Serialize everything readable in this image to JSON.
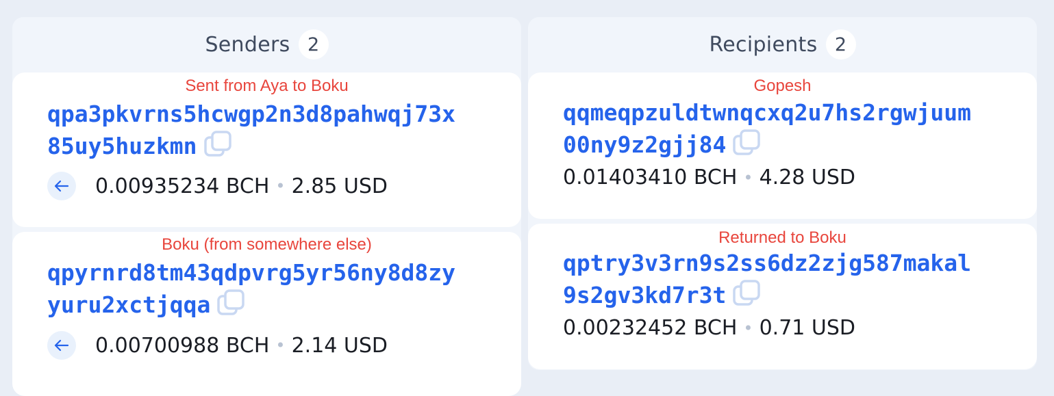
{
  "senders": {
    "title": "Senders",
    "count": "2",
    "items": [
      {
        "label": "Sent from Aya to Boku",
        "address_line1": "qpa3pkvrns5hcwgp2n3d8pahwqj73x",
        "address_line2": "85uy5huzkmn",
        "bch": "0.00935234 BCH",
        "usd": "2.85 USD",
        "icon": "arrow-left-icon"
      },
      {
        "label": "Boku (from somewhere else)",
        "address_line1": "qpyrnrd8tm43qdpvrg5yr56ny8d8zy",
        "address_line2": "yuru2xctjqqa",
        "bch": "0.00700988 BCH",
        "usd": "2.14 USD",
        "icon": "arrow-left-icon"
      }
    ]
  },
  "recipients": {
    "title": "Recipients",
    "count": "2",
    "items": [
      {
        "label": "Gopesh",
        "address_line1": "qqmeqpzuldtwnqcxq2u7hs2rgwjuum",
        "address_line2": "00ny9z2gjj84",
        "bch": "0.01403410 BCH",
        "usd": "4.28 USD"
      },
      {
        "label": "Returned to Boku",
        "address_line1": "qptry3v3rn9s2ss6dz2zjg587makal",
        "address_line2": "9s2gv3kd7r3t",
        "bch": "0.00232452 BCH",
        "usd": "0.71 USD"
      }
    ]
  },
  "separator": "•",
  "colors": {
    "address": "#2563eb",
    "label": "#e8453c",
    "background": "#e9eef6",
    "card": "#ffffff"
  }
}
